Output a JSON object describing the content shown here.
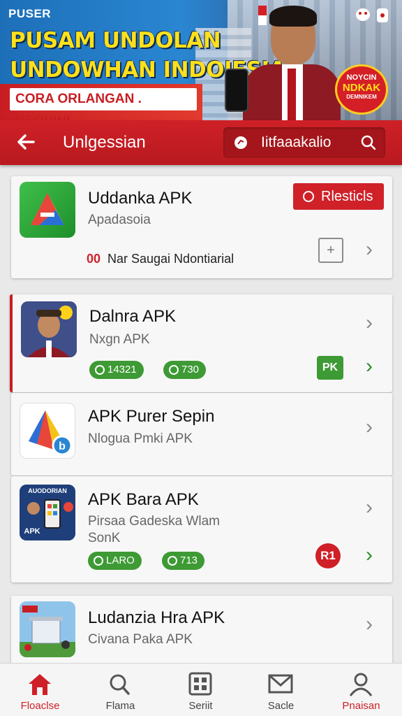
{
  "banner": {
    "small": "PUSER",
    "line1": "PUSAM UNDOLAN",
    "line2": "UNDOWHAN INDOIESIA!",
    "sub": "CORA ORLANGAN . DEOVINI",
    "badge": [
      "NOYCIN",
      "NDKAK",
      "DEMNIKEM"
    ]
  },
  "header": {
    "back_icon": "arrow-left-icon",
    "title": "Unlgessian",
    "search_text": "Iitfaaakalio"
  },
  "apps": [
    {
      "name": "Uddanka APK",
      "sub": "Apadasoia",
      "button": "Rlesticls",
      "note_prefix": "00",
      "note": "Nar Saugai Ndontiarial"
    },
    {
      "name": "Dalnra APK",
      "sub": "Nxgn APK",
      "pill1": "14321",
      "pill2": "730",
      "badge": "PK"
    },
    {
      "name": "APK Purer Sepin",
      "sub": "Nlogua Pmki APK"
    },
    {
      "name": "APK Bara APK",
      "sub1": "Pirsaa Gadeska Wlam",
      "sub2": "SonK",
      "pill1": "LARO",
      "pill2": "713",
      "badge": "R1",
      "icon_text1": "AUODORIAN",
      "icon_text2": "APK"
    },
    {
      "name": "Ludanzia Hra APK",
      "sub": "Civana Paka APK"
    }
  ],
  "bottom_nav": [
    {
      "label": "Floaclse",
      "icon": "home-icon"
    },
    {
      "label": "Flama",
      "icon": "search-icon"
    },
    {
      "label": "Seriit",
      "icon": "grid-icon"
    },
    {
      "label": "Sacle",
      "icon": "mail-icon"
    },
    {
      "label": "Pnaisan",
      "icon": "user-icon"
    }
  ],
  "colors": {
    "brand_red": "#cf2027",
    "accent_green": "#3d9a34"
  }
}
